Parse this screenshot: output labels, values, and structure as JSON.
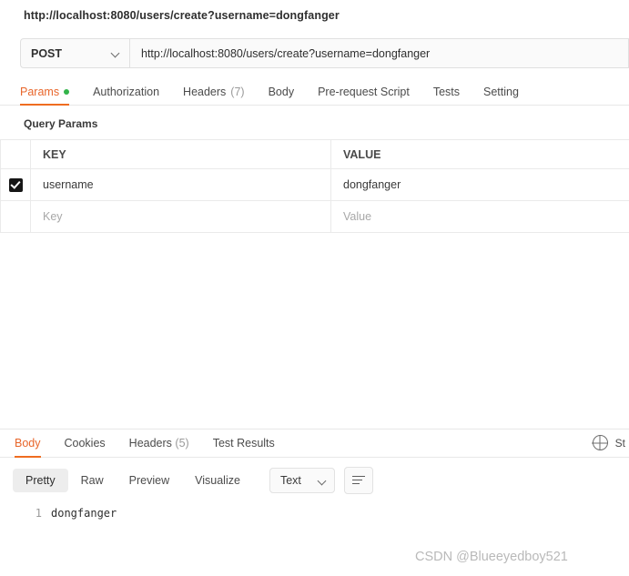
{
  "request": {
    "title": "http://localhost:8080/users/create?username=dongfanger",
    "method": "POST",
    "url": "http://localhost:8080/users/create?username=dongfanger",
    "tabs": [
      {
        "label": "Params",
        "badge": "dot",
        "active": true
      },
      {
        "label": "Authorization",
        "badge": "",
        "active": false
      },
      {
        "label": "Headers",
        "badge": "(7)",
        "active": false
      },
      {
        "label": "Body",
        "badge": "",
        "active": false
      },
      {
        "label": "Pre-request Script",
        "badge": "",
        "active": false
      },
      {
        "label": "Tests",
        "badge": "",
        "active": false
      },
      {
        "label": "Setting",
        "badge": "",
        "active": false
      }
    ]
  },
  "query_params": {
    "section_label": "Query Params",
    "columns": [
      "",
      "KEY",
      "VALUE"
    ],
    "rows": [
      {
        "checked": true,
        "key": "username",
        "value": "dongfanger"
      }
    ],
    "new_row": {
      "key_placeholder": "Key",
      "value_placeholder": "Value"
    }
  },
  "response": {
    "tabs": [
      {
        "label": "Body",
        "badge": "",
        "active": true
      },
      {
        "label": "Cookies",
        "badge": "",
        "active": false
      },
      {
        "label": "Headers",
        "badge": "(5)",
        "active": false
      },
      {
        "label": "Test Results",
        "badge": "",
        "active": false
      }
    ],
    "status_text": "St",
    "view_modes": [
      {
        "label": "Pretty",
        "active": true
      },
      {
        "label": "Raw",
        "active": false
      },
      {
        "label": "Preview",
        "active": false
      },
      {
        "label": "Visualize",
        "active": false
      }
    ],
    "type_select": "Text",
    "body_lines": [
      {
        "number": "1",
        "text": "dongfanger"
      }
    ]
  },
  "watermark": "CSDN @Blueeyedboy521",
  "colors": {
    "accent": "#ef6c20",
    "dot_green": "#32b44a",
    "muted": "#9a9a9a"
  }
}
